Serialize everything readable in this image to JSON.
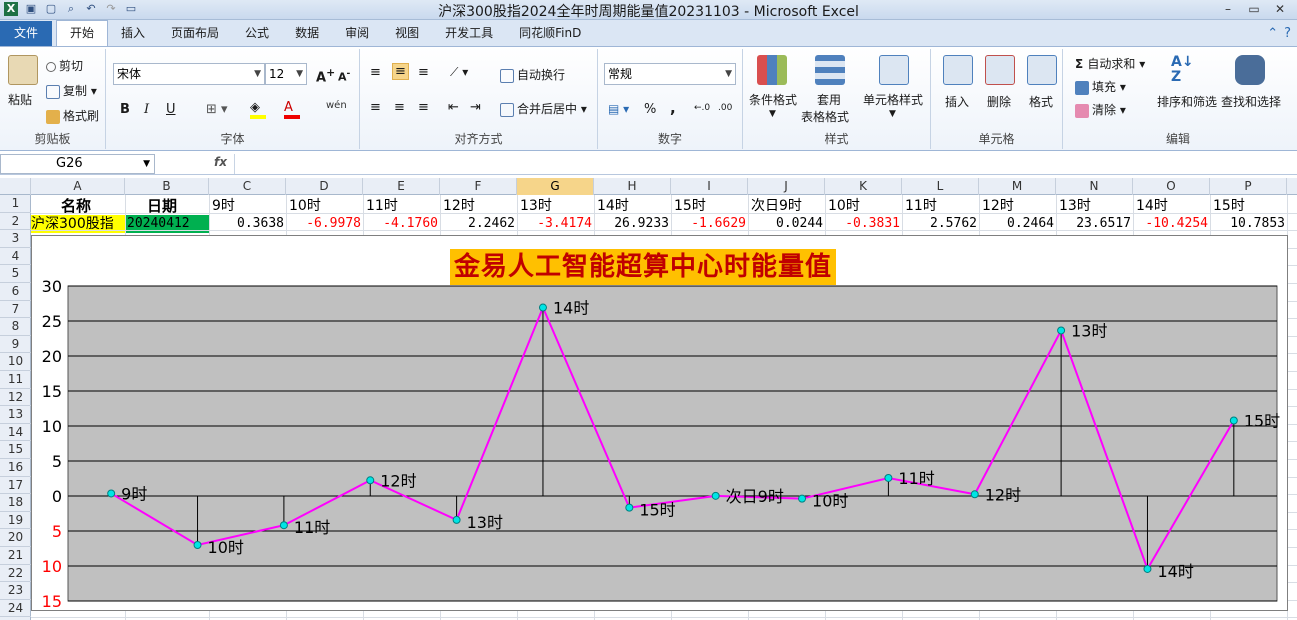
{
  "window": {
    "title": "沪深300股指2024全年时周期能量值20231103 - Microsoft Excel"
  },
  "tabs": [
    "文件",
    "开始",
    "插入",
    "页面布局",
    "公式",
    "数据",
    "审阅",
    "视图",
    "开发工具",
    "同花顺FinD"
  ],
  "active_tab": "开始",
  "ribbon": {
    "clipboard": {
      "paste": "粘贴",
      "cut": "剪切",
      "copy": "复制",
      "format_painter": "格式刷",
      "label": "剪贴板"
    },
    "font": {
      "name": "宋体",
      "size": "12",
      "bold": "B",
      "italic": "I",
      "underline": "U",
      "label": "字体",
      "wen": "wén"
    },
    "alignment": {
      "wrap": "自动换行",
      "merge": "合并后居中",
      "label": "对齐方式"
    },
    "number": {
      "format": "常规",
      "percent": "%",
      "comma": ",",
      "label": "数字"
    },
    "styles": {
      "cond": "条件格式",
      "table1": "套用",
      "table2": "表格格式",
      "cell": "单元格样式",
      "label": "样式"
    },
    "cells": {
      "insert": "插入",
      "delete": "删除",
      "format": "格式",
      "label": "单元格"
    },
    "editing": {
      "autosum": "自动求和",
      "fill": "填充",
      "clear": "清除",
      "sort": "排序和筛选",
      "find": "查找和选择",
      "label": "编辑"
    }
  },
  "formula_bar": {
    "name_box": "G26",
    "fx": "fx",
    "content": ""
  },
  "columns": [
    "A",
    "B",
    "C",
    "D",
    "E",
    "F",
    "G",
    "H",
    "I",
    "J",
    "K",
    "L",
    "M",
    "N",
    "O",
    "P"
  ],
  "selected_column": "G",
  "rows": [
    "1",
    "2",
    "3",
    "4",
    "5",
    "6",
    "7",
    "8",
    "9",
    "10",
    "11",
    "12",
    "13",
    "14",
    "15",
    "16",
    "17",
    "18",
    "19",
    "20",
    "21",
    "22",
    "23",
    "24"
  ],
  "row1": [
    "名称",
    "日期",
    "9时",
    "10时",
    "11时",
    "12时",
    "13时",
    "14时",
    "15时",
    "次日9时",
    "10时",
    "11时",
    "12时",
    "13时",
    "14时",
    "15时"
  ],
  "row2": {
    "name": "沪深300股指",
    "date": "20240412",
    "values": [
      "0.3638",
      "-6.9978",
      "-4.1760",
      "2.2462",
      "-3.4174",
      "26.9233",
      "-1.6629",
      "0.0244",
      "-0.3831",
      "2.5762",
      "0.2464",
      "23.6517",
      "-10.4254",
      "10.7853"
    ]
  },
  "colors": {
    "negative": "#ff0000",
    "name_bg": "#ffff00",
    "date_bg": "#00b050",
    "line": "#ff00ff",
    "marker": "#00e5e5",
    "plot_bg": "#c0c0c0",
    "title_bg": "#ffc000",
    "title_fg": "#c00000"
  },
  "chart_data": {
    "type": "line",
    "title": "金易人工智能超算中心时能量值",
    "categories": [
      "9时",
      "10时",
      "11时",
      "12时",
      "13时",
      "14时",
      "15时",
      "次日9时",
      "10时",
      "11时",
      "12时",
      "13时",
      "14时",
      "15时"
    ],
    "series": [
      {
        "values": [
          0.3638,
          -6.9978,
          -4.176,
          2.2462,
          -3.4174,
          26.9233,
          -1.6629,
          0.0244,
          -0.3831,
          2.5762,
          0.2464,
          23.6517,
          -10.4254,
          10.7853
        ]
      }
    ],
    "ylim": [
      -15,
      30
    ],
    "yticks": [
      "30",
      "25",
      "20",
      "15",
      "10",
      "5",
      "0",
      "5",
      "10",
      "15"
    ],
    "grid": true,
    "drop_lines": true,
    "xlabel": "",
    "ylabel": ""
  }
}
